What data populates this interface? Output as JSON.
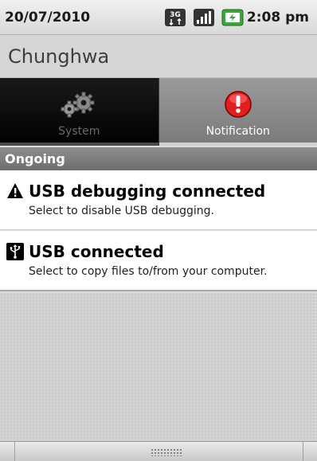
{
  "status_bar": {
    "date": "20/07/2010",
    "time": "2:08 pm",
    "icons": [
      "3g-data-icon",
      "signal-strength-icon",
      "battery-charging-icon"
    ]
  },
  "carrier": {
    "name": "Chunghwa"
  },
  "tabs": [
    {
      "label": "System",
      "icon": "gears-icon",
      "selected": false
    },
    {
      "label": "Notification",
      "icon": "alert-icon",
      "selected": true
    }
  ],
  "section": {
    "title": "Ongoing"
  },
  "notifications": [
    {
      "icon": "warning-icon",
      "title": "USB debugging connected",
      "text": "Select to disable USB debugging."
    },
    {
      "icon": "usb-icon",
      "title": "USB connected",
      "text": "Select to copy files to/from your computer."
    }
  ],
  "colors": {
    "alert_red": "#e02020",
    "battery_green": "#3aa63a",
    "section_header": "#7a7a7a"
  }
}
